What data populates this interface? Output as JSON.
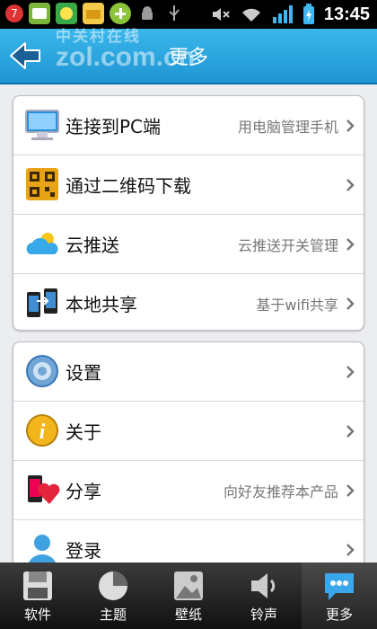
{
  "status": {
    "time": "13:45",
    "badge": "7"
  },
  "header": {
    "title": "更多"
  },
  "watermark": {
    "line1": "中关村在线",
    "line2": "zol.com.cn"
  },
  "section1": [
    {
      "label": "连接到PC端",
      "sub": "用电脑管理手机",
      "icon": "monitor-icon"
    },
    {
      "label": "通过二维码下载",
      "sub": "",
      "icon": "qr-code-icon"
    },
    {
      "label": "云推送",
      "sub": "云推送开关管理",
      "icon": "cloud-push-icon"
    },
    {
      "label": "本地共享",
      "sub": "基于wifi共享",
      "icon": "phone-share-icon"
    }
  ],
  "section2": [
    {
      "label": "设置",
      "sub": "",
      "icon": "gear-icon"
    },
    {
      "label": "关于",
      "sub": "",
      "icon": "info-icon"
    },
    {
      "label": "分享",
      "sub": "向好友推荐本产品",
      "icon": "share-heart-icon"
    },
    {
      "label": "登录",
      "sub": "",
      "icon": "user-icon"
    }
  ],
  "tabs": [
    {
      "label": "软件",
      "icon": "floppy-icon"
    },
    {
      "label": "主题",
      "icon": "pie-theme-icon"
    },
    {
      "label": "壁纸",
      "icon": "wallpaper-icon"
    },
    {
      "label": "铃声",
      "icon": "speaker-icon"
    },
    {
      "label": "更多",
      "icon": "chat-more-icon"
    }
  ],
  "colors": {
    "header": "#1f95d4",
    "accent": "#3ab7ea"
  }
}
